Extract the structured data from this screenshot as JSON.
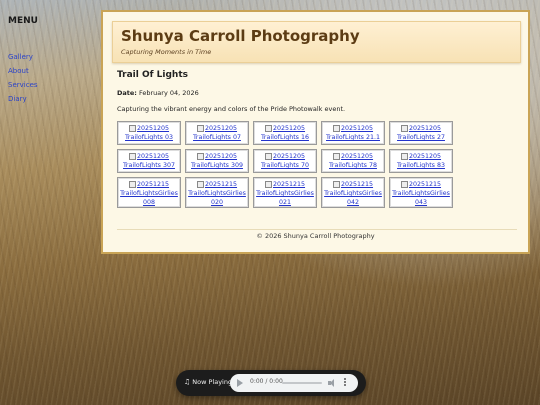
{
  "sidebar": {
    "menu_label": "MENU",
    "items": [
      {
        "label": "Gallery"
      },
      {
        "label": "About"
      },
      {
        "label": "Services"
      },
      {
        "label": "Diary"
      }
    ]
  },
  "header": {
    "title": "Shunya Carroll Photography",
    "tagline": "Capturing Moments in Time"
  },
  "album": {
    "title": "Trail Of Lights",
    "date_label": "Date:",
    "date_value": "February 04, 2026",
    "description": "Capturing the vibrant energy and colors of the Pride Photowalk event."
  },
  "thumbnails": [
    [
      "20251205",
      "TrailofLights 03"
    ],
    [
      "20251205",
      "TrailofLights 07"
    ],
    [
      "20251205",
      "TrailofLights 16"
    ],
    [
      "20251205",
      "TrailofLights 21.1"
    ],
    [
      "20251205",
      "TrailofLights 27"
    ],
    [
      "20251205",
      "TrailofLights 307"
    ],
    [
      "20251205",
      "TrailofLights 309"
    ],
    [
      "20251205",
      "TrailofLights 70"
    ],
    [
      "20251205",
      "TrailofLights 78"
    ],
    [
      "20251205",
      "TrailofLights 83"
    ],
    [
      "20251215",
      "TrailofLightsGirlies 008"
    ],
    [
      "20251215",
      "TrailofLightsGirlies 020"
    ],
    [
      "20251215",
      "TrailofLightsGirlies 021"
    ],
    [
      "20251215",
      "TrailofLightsGirlies 042"
    ],
    [
      "20251215",
      "TrailofLightsGirlies 043"
    ]
  ],
  "footer": {
    "text": "© 2026 Shunya Carroll Photography"
  },
  "player": {
    "label": "Now Playing",
    "time": "0:00 / 0:00",
    "icons": {
      "note": "music-note-icon",
      "play": "play-icon",
      "volume": "volume-icon",
      "more": "more-vert-icon"
    }
  }
}
